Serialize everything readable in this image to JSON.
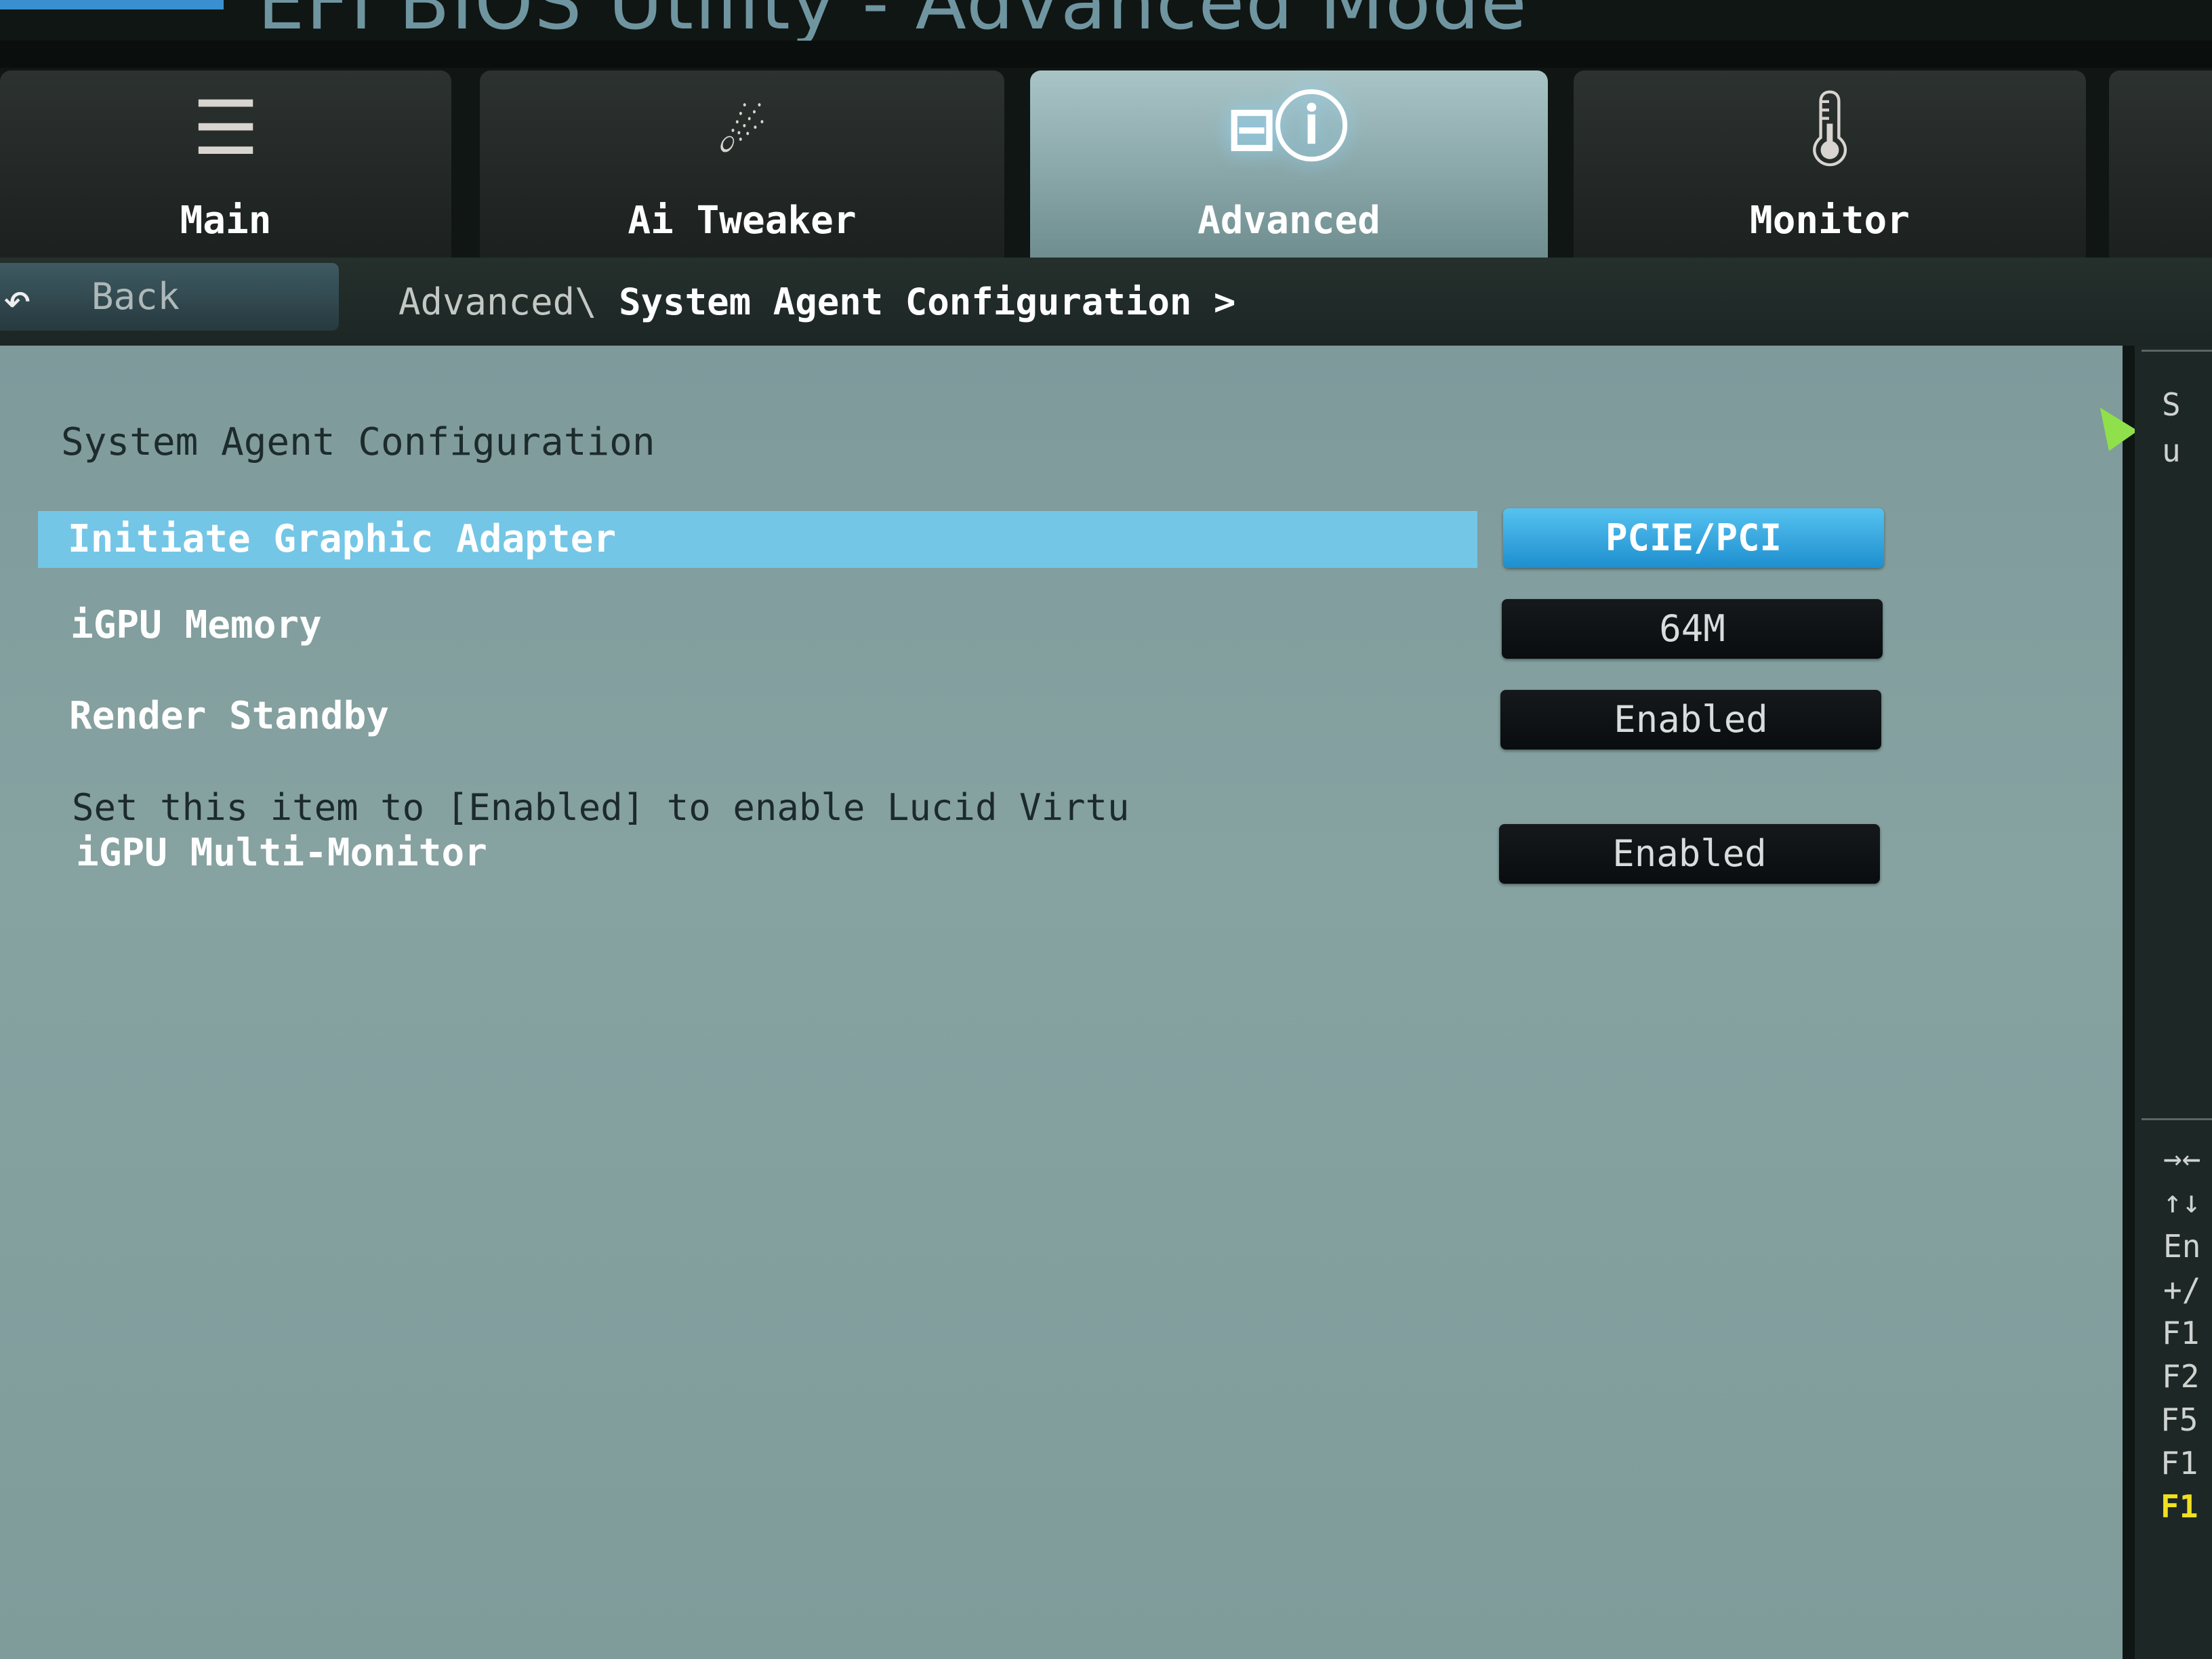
{
  "header": {
    "title": "EFI BIOS Utility - Advanced Mode"
  },
  "tabs": [
    {
      "label": "Main",
      "icon": "list-icon",
      "active": false
    },
    {
      "label": "Ai Tweaker",
      "icon": "tweaker-icon",
      "active": false
    },
    {
      "label": "Advanced",
      "icon": "advanced-info-icon",
      "active": true
    },
    {
      "label": "Monitor",
      "icon": "thermometer-gauge-icon",
      "active": false
    }
  ],
  "nav": {
    "back_label": "Back",
    "breadcrumb_parent": "Advanced\\",
    "breadcrumb_current": "System Agent Configuration >"
  },
  "main": {
    "section_title": "System Agent Configuration",
    "settings": [
      {
        "label": "Initiate Graphic Adapter",
        "value": "PCIE/PCI",
        "selected": true
      },
      {
        "label": "iGPU Memory",
        "value": "64M",
        "selected": false
      },
      {
        "label": "Render Standby",
        "value": "Enabled",
        "selected": false
      },
      {
        "label": "iGPU Multi-Monitor",
        "value": "Enabled",
        "selected": false
      }
    ],
    "help_text": "Set this item to [Enabled] to enable Lucid Virtu"
  },
  "sidebar": {
    "help_lines": [
      "S",
      "u"
    ],
    "keys": [
      "→←",
      "↑↓",
      "En",
      "+/",
      "F1",
      "F2",
      "F5",
      "F1",
      "F1"
    ],
    "highlight_color": "#f0e020"
  },
  "colors": {
    "selected_row": "#73c6e6",
    "selected_button": "#2a9fd8",
    "panel": "#7e9a9b"
  }
}
